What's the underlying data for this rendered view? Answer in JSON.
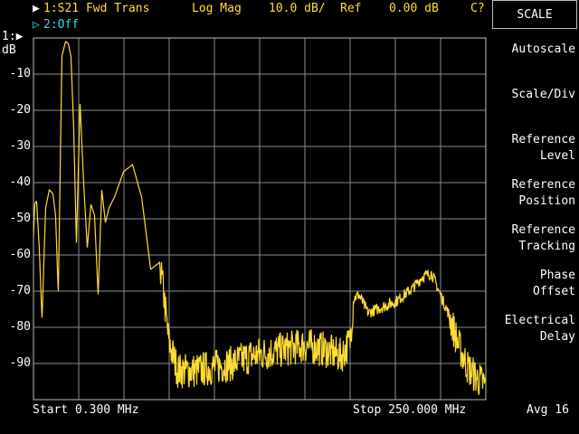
{
  "header": {
    "trace1_marker": "▶",
    "trace1_label": "1:S21 Fwd Trans",
    "format": "Log Mag",
    "scale": "10.0 dB/",
    "ref_label": "Ref",
    "ref_value": "0.00 dB",
    "cal_status": "C?",
    "trace2_marker": "▷",
    "trace2_label": "2:Off"
  },
  "axis": {
    "ref_marker": "1:▶",
    "unit": "dB",
    "y_labels": [
      "-10",
      "-20",
      "-30",
      "-40",
      "-50",
      "-60",
      "-70",
      "-80",
      "-90"
    ]
  },
  "footer": {
    "start": "Start 0.300 MHz",
    "stop": "Stop 250.000 MHz",
    "avg": "Avg 16"
  },
  "menu": {
    "title": "SCALE",
    "items": [
      {
        "line1": "Autoscale",
        "line2": ""
      },
      {
        "line1": "Scale/Div",
        "line2": ""
      },
      {
        "line1": "Reference",
        "line2": "Level"
      },
      {
        "line1": "Reference",
        "line2": "Position"
      },
      {
        "line1": "Reference",
        "line2": "Tracking"
      },
      {
        "line1": "Phase",
        "line2": "Offset"
      },
      {
        "line1": "Electrical",
        "line2": "Delay"
      }
    ]
  },
  "colors": {
    "trace": "#ffdd33",
    "grid": "#8c8c8c",
    "text": "#ffffff",
    "trace2": "#33dddd"
  },
  "chart_data": {
    "type": "line",
    "x_unit": "MHz",
    "y_unit": "dB",
    "xlim": [
      0.3,
      250
    ],
    "ylim": [
      -100,
      0
    ],
    "grid": true,
    "series": [
      {
        "name": "S21 Fwd Trans",
        "x": [
          0.3,
          1,
          2,
          3.5,
          5,
          7,
          9,
          11,
          12.5,
          14,
          16,
          18,
          19.5,
          21,
          22.5,
          24,
          26,
          28,
          30,
          32,
          34,
          36,
          38,
          40,
          42,
          45,
          50,
          55,
          60,
          65,
          70,
          72,
          75,
          80,
          90,
          100,
          110,
          120,
          130,
          140,
          150,
          160,
          170,
          175,
          177,
          180,
          185,
          190,
          200,
          210,
          215,
          220,
          225,
          230,
          235,
          240,
          245,
          250
        ],
        "y": [
          -55,
          -46,
          -45,
          -58,
          -78,
          -47,
          -42,
          -43,
          -49,
          -71,
          -5,
          -1,
          -1.5,
          -5,
          -25,
          -57,
          -18,
          -40,
          -58,
          -46,
          -49,
          -71,
          -42,
          -51,
          -47,
          -44,
          -37,
          -35,
          -44,
          -64,
          -62,
          -70,
          -84,
          -92,
          -92,
          -91,
          -90,
          -88,
          -87,
          -86,
          -85,
          -86,
          -88,
          -84,
          -72,
          -71,
          -76,
          -75,
          -73,
          -69,
          -66,
          -65,
          -71,
          -77,
          -85,
          -91,
          -94,
          -96
        ]
      }
    ]
  }
}
